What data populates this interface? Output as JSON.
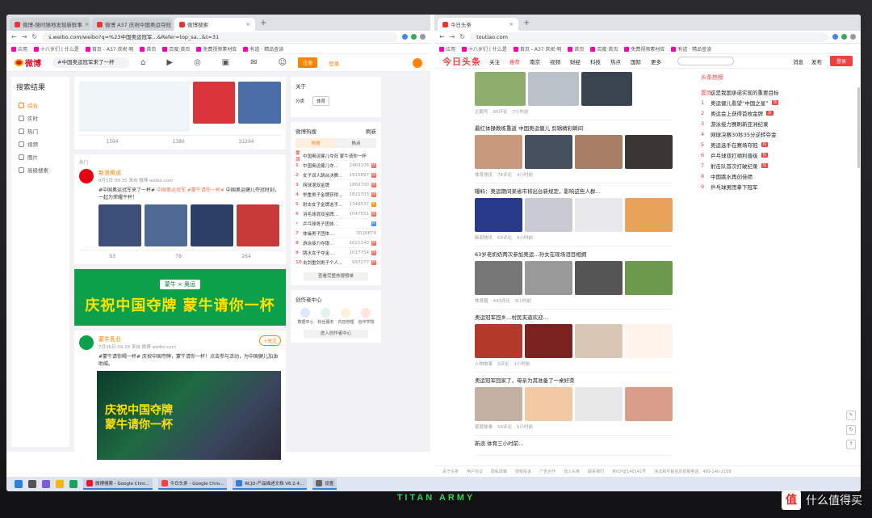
{
  "weibo_window": {
    "tabs": [
      {
        "label": "微博-随时随地发现新鲜事",
        "active": false
      },
      {
        "label": "微博 A37 庆祝中国奥运夺冠",
        "active": false
      },
      {
        "label": "微博搜索",
        "active": true
      }
    ],
    "url": "s.weibo.com/weibo?q=%23中国奥运冠军...&Refer=top_sa...&t=31",
    "bookmarks": [
      "应用",
      "十八岁们 | 什么是",
      "首页 - A37 庆祝·明",
      "首页",
      "百度·首页",
      "免费视频素材库",
      "有道 · 精品查读"
    ],
    "logo": "微博",
    "search_value": "#中国奥运冠军来了一杯",
    "nav_icons": [
      "home-icon",
      "video-icon",
      "discover-icon",
      "game-icon",
      "message-icon",
      "profile-icon"
    ],
    "register_label": "注册",
    "login_label": "登录",
    "sidebar": {
      "title": "搜索结果",
      "items": [
        {
          "label": "综合",
          "active": true
        },
        {
          "label": "实时",
          "active": false
        },
        {
          "label": "热门",
          "active": false
        },
        {
          "label": "视频",
          "active": false
        },
        {
          "label": "图片",
          "active": false
        },
        {
          "label": "高级搜索",
          "active": false
        }
      ]
    },
    "feed": {
      "card1_stats": {
        "forward": "1594",
        "comment": "1380",
        "like": "32294"
      },
      "post2": {
        "section": "热门",
        "author": "新浪奥运",
        "meta": "8月1日 09:35 来自 微博 weibo.com",
        "text_before": "#中国奥运冠军来了一杯# ",
        "text_highlight": "中国奥运冠军 #蒙牛请你一杯#",
        "text_after": " 中国奥运健儿夺冠时刻，一起为荣耀干杯！",
        "stats": {
          "forward": "93",
          "comment": "78",
          "like": "264"
        }
      },
      "banner": {
        "brand": "蒙牛 × 奥运",
        "slogan": "庆祝中国夺牌  蒙牛请你一杯"
      },
      "post3": {
        "author": "蒙牛乳业",
        "meta": "7月26日 09:18 来自 微博 weibo.com",
        "follow_label": "+关注",
        "text": "#蒙牛请你喝一杯# 庆祝中国夺牌，蒙牛请你一杯！点击参与活动，为中国健儿加油助威。",
        "ad_slogan": "庆祝中国夺牌 蒙牛请你一杯"
      }
    },
    "right": {
      "follow_title": "关于",
      "follow_label": "分类",
      "follow_tag": "体育",
      "hot_title": "微博热搜",
      "refresh_label": "刷新",
      "hot_tabs": [
        "热搜",
        "热点"
      ],
      "hot_list": [
        {
          "rank": "置顶",
          "title": "中国奥运健儿夺冠 蒙牛请你一杯",
          "num": "",
          "badge": ""
        },
        {
          "rank": "1",
          "title": "中国奥运健儿夺…",
          "num": "2469106",
          "badge": "热"
        },
        {
          "rank": "2",
          "title": "女子双人跳台决赛…",
          "num": "1915897",
          "badge": "热"
        },
        {
          "rank": "3",
          "title": "网球混双金牌",
          "num": "1869700",
          "badge": "热"
        },
        {
          "rank": "4",
          "title": "举重男子金牌获得…",
          "num": "1821703",
          "badge": "热"
        },
        {
          "rank": "5",
          "title": "射击女子金牌选手…",
          "num": "1349537",
          "badge": "新"
        },
        {
          "rank": "6",
          "title": "羽毛球混双金牌…",
          "num": "1047551",
          "badge": "热"
        },
        {
          "rank": "•",
          "title": "乒乓球男子团体…",
          "num": "",
          "badge": "荐"
        },
        {
          "rank": "7",
          "title": "体操男子团体…",
          "num": "1026874",
          "badge": ""
        },
        {
          "rank": "8",
          "title": "游泳接力夺银…",
          "num": "1021140",
          "badge": "热"
        },
        {
          "rank": "9",
          "title": "跳水女子夺金…",
          "num": "1017754",
          "badge": "热"
        },
        {
          "rank": "10",
          "title": "击剑重剑男子个人…",
          "num": "997277",
          "badge": "热"
        }
      ],
      "more_label": "查看完整热搜榜单",
      "creator_title": "创作者中心",
      "creator_items": [
        "数据中心",
        "粉丝服务",
        "内容管理",
        "创作学院"
      ],
      "creator_btn": "进入创作者中心"
    }
  },
  "toutiao_window": {
    "tabs": [
      {
        "label": "今日头条",
        "active": true
      }
    ],
    "url": "toutiao.com",
    "bookmarks": [
      "应用",
      "十八岁们 | 什么是",
      "首页 - A37 庆祝·明",
      "首页",
      "百度·首页",
      "免费视频素材库",
      "有道 · 精品查读"
    ],
    "logo": "今日头条",
    "nav": [
      "关注",
      "推荐",
      "南京",
      "视频",
      "财经",
      "科技",
      "热点",
      "国际",
      "更多"
    ],
    "active_nav": "推荐",
    "top_right": [
      "消息",
      "发布"
    ],
    "login_label": "登录",
    "items": [
      {
        "title": "",
        "meta": [
          "企鹅号",
          "95评论",
          "7小时前"
        ],
        "imgs": [
          "#8fae6d",
          "#b9c2c9",
          "#3a4350"
        ]
      },
      {
        "title": "最红体操教练重返 中国奥运健儿 剪辑精彩瞬间",
        "meta": [
          "体育快讯",
          "74评论",
          "4小时前"
        ],
        "imgs": [
          "#c79a7b",
          "#46505e",
          "#a87d65",
          "#3b3434"
        ]
      },
      {
        "title": "曝料：奥运期间某省市将出台新规定，影响这些人群…",
        "meta": [
          "新闻快讯",
          "63评论",
          "3小时前"
        ],
        "imgs": [
          "#2a3a8a",
          "#c8cbd4",
          "#e9e9ec",
          "#e8a35a"
        ]
      },
      {
        "title": "63岁老奶奶两次参加奥运…孙女在现场泪目相拥",
        "meta": [
          "体育圈",
          "443评论",
          "9小时前"
        ],
        "imgs": [
          "#777",
          "#999",
          "#555",
          "#6a9a4a"
        ]
      },
      {
        "title": "奥运冠军回乡…村民夹道欢迎…",
        "meta": [
          "人物故事",
          "2评论",
          "1小时前"
        ],
        "imgs": [
          "#b23a2a",
          "#7a2220",
          "#d9c7b5",
          "#fff3ec"
        ]
      },
      {
        "title": "奥运冠军回家了，母亲为其准备了一桌好菜",
        "meta": [
          "家庭故事",
          "56评论",
          "5小时前"
        ],
        "imgs": [
          "#c4b0a0",
          "#f3c9a3",
          "#e7e7e7",
          "#d89e8a"
        ]
      },
      {
        "title": "新浪 体育三小时前…",
        "meta": [],
        "imgs": []
      }
    ],
    "side_title": "头条热榜",
    "hot": [
      {
        "rank": "置顶",
        "title": "这是我国承诺实现的重要目标",
        "badge": ""
      },
      {
        "rank": "1",
        "title": "奥运健儿看望“中国之星”",
        "badge": "热"
      },
      {
        "rank": "2",
        "title": "奥运会上获得首枚金牌",
        "badge": "热"
      },
      {
        "rank": "3",
        "title": "游泳接力赛刷新亚洲纪录",
        "badge": ""
      },
      {
        "rank": "4",
        "title": "网球决赛30秒35分逆转夺金",
        "badge": ""
      },
      {
        "rank": "5",
        "title": "奥运选手在赛场夺冠",
        "badge": "热"
      },
      {
        "rank": "6",
        "title": "乒乓球双打顺利晋级",
        "badge": "热"
      },
      {
        "rank": "7",
        "title": "射击队首次打破纪录",
        "badge": "热"
      },
      {
        "rank": "8",
        "title": "中国跳水再创佳绩",
        "badge": ""
      },
      {
        "rank": "9",
        "title": "乒乓球男团拿下冠军",
        "badge": ""
      }
    ],
    "footer": [
      "关于头条",
      "用户协议",
      "隐私政策",
      "侵权投诉",
      "广告合作",
      "加入头条",
      "联系我们",
      "京ICP证140141号",
      "违法和不良信息举报电话：400-140-2108"
    ]
  },
  "taskbar": {
    "apps": [
      {
        "label": "微博搜索 - Google Chro...",
        "color": "#e6162d"
      },
      {
        "label": "今日头条 - Google Chro...",
        "color": "#f04142"
      },
      {
        "label": "RCJD-产品描述文档 V6.2.4...",
        "color": "#3a7bd5"
      }
    ],
    "tray": [
      "设置"
    ]
  },
  "monitor_brand": "TITAN ARMY",
  "watermark": "什么值得买"
}
